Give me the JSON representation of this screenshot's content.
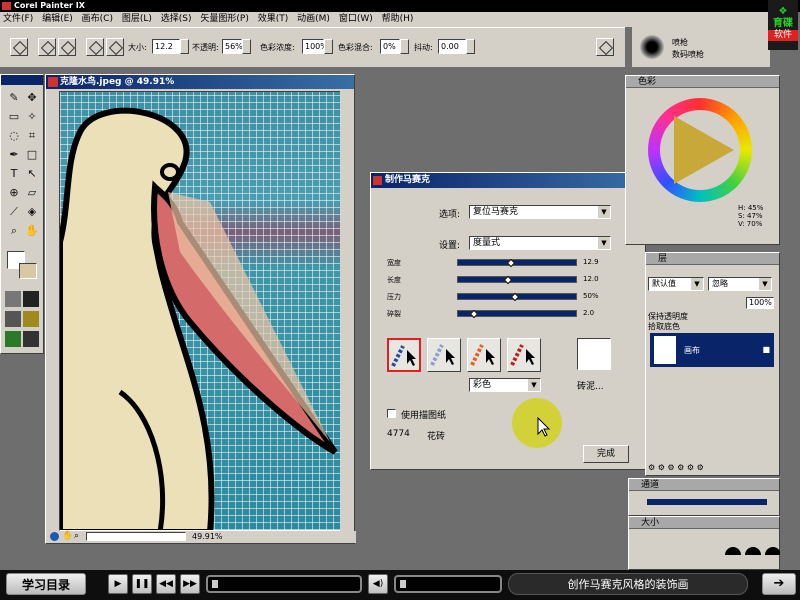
{
  "app": {
    "title": "Corel Painter IX",
    "brand_top": "育碟",
    "brand_bottom": "软件"
  },
  "menu": [
    "文件(F)",
    "编辑(E)",
    "画布(C)",
    "图层(L)",
    "选择(S)",
    "矢量图形(P)",
    "效果(T)",
    "动画(M)",
    "窗口(W)",
    "帮助(H)"
  ],
  "propbar": {
    "size_label": "大小:",
    "size_value": "12.2",
    "opacity_label": "不透明:",
    "opacity_value": "56%",
    "resat_label": "色彩浓度:",
    "resat_value": "100%",
    "bleed_label": "色彩混合:",
    "bleed_value": "0%",
    "jitter_label": "抖动:",
    "jitter_value": "0.00",
    "brush_line1": "喷枪",
    "brush_line2": "数码喷枪"
  },
  "document": {
    "title": "克隆水鸟.jpeg @ 49.91%",
    "zoom": "49.91%"
  },
  "dialog": {
    "title": "制作马赛克",
    "options_label": "选项:",
    "options_value": "复位马赛克",
    "settings_label": "设置:",
    "settings_value": "度量式",
    "sliders": [
      {
        "label": "宽度",
        "value": "12.9",
        "pos": 0.45
      },
      {
        "label": "长度",
        "value": "12.0",
        "pos": 0.42
      },
      {
        "label": "压力",
        "value": "50%",
        "pos": 0.48
      },
      {
        "label": "碎裂",
        "value": "2.0",
        "pos": 0.12
      }
    ],
    "color_mode": "彩色",
    "grout_label": "砖泥...",
    "use_tracing_label": "使用描图纸",
    "tile_count": "4774",
    "tile_label": "花砖",
    "done_label": "完成"
  },
  "color_panel": {
    "title": "色彩",
    "hsv": [
      "H: 45%",
      "S: 47%",
      "V: 70%"
    ]
  },
  "layers_panel": {
    "title": "层",
    "composite": "默认值",
    "method": "忽略",
    "opacity": "100%",
    "preserve": "保持透明度",
    "pick_up": "拾取底色",
    "layer_name": "画布"
  },
  "channels_panel": {
    "title": "通道"
  },
  "size_panel": {
    "title": "大小"
  },
  "player": {
    "toc_label": "学习目录",
    "caption": "创作马赛克风格的装饰画",
    "next_label": "➔"
  },
  "colors": {
    "accent": "#0a246a",
    "selection_border": "#e02020",
    "highlight": "#d2d228"
  }
}
